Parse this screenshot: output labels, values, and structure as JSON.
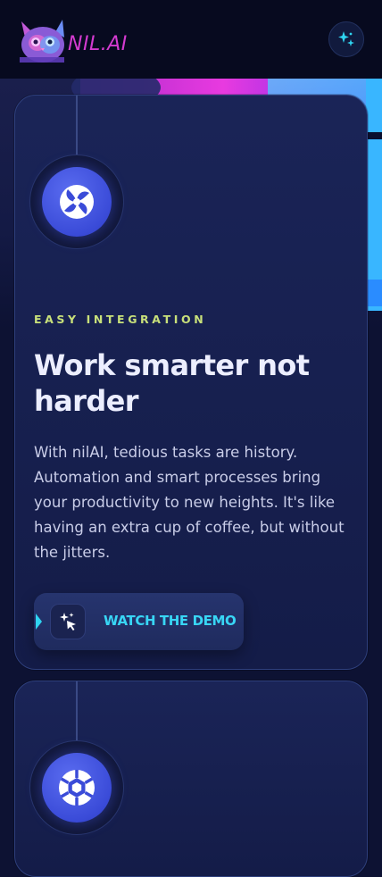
{
  "header": {
    "brand": "NIL.AI",
    "logo_icon": "cat-logo-icon",
    "action_icon": "sparkle-icon"
  },
  "feature_card": {
    "icon": "swirl-icon",
    "eyebrow": "EASY INTEGRATION",
    "title": "Work smarter not harder",
    "description": "With nilAI, tedious tasks are history. Automation and smart processes bring your productivity to new heights. It's like having an extra cup of coffee, but without the jitters.",
    "cta_icon": "sparkle-cursor-icon",
    "cta_label": "WATCH THE DEMO"
  },
  "next_card": {
    "icon": "aperture-icon"
  },
  "colors": {
    "accent_cyan": "#38d6f5",
    "eyebrow_green": "#c8e07a",
    "brand_magenta": "#d43bd0",
    "icon_blue": "#3a4bd8"
  }
}
